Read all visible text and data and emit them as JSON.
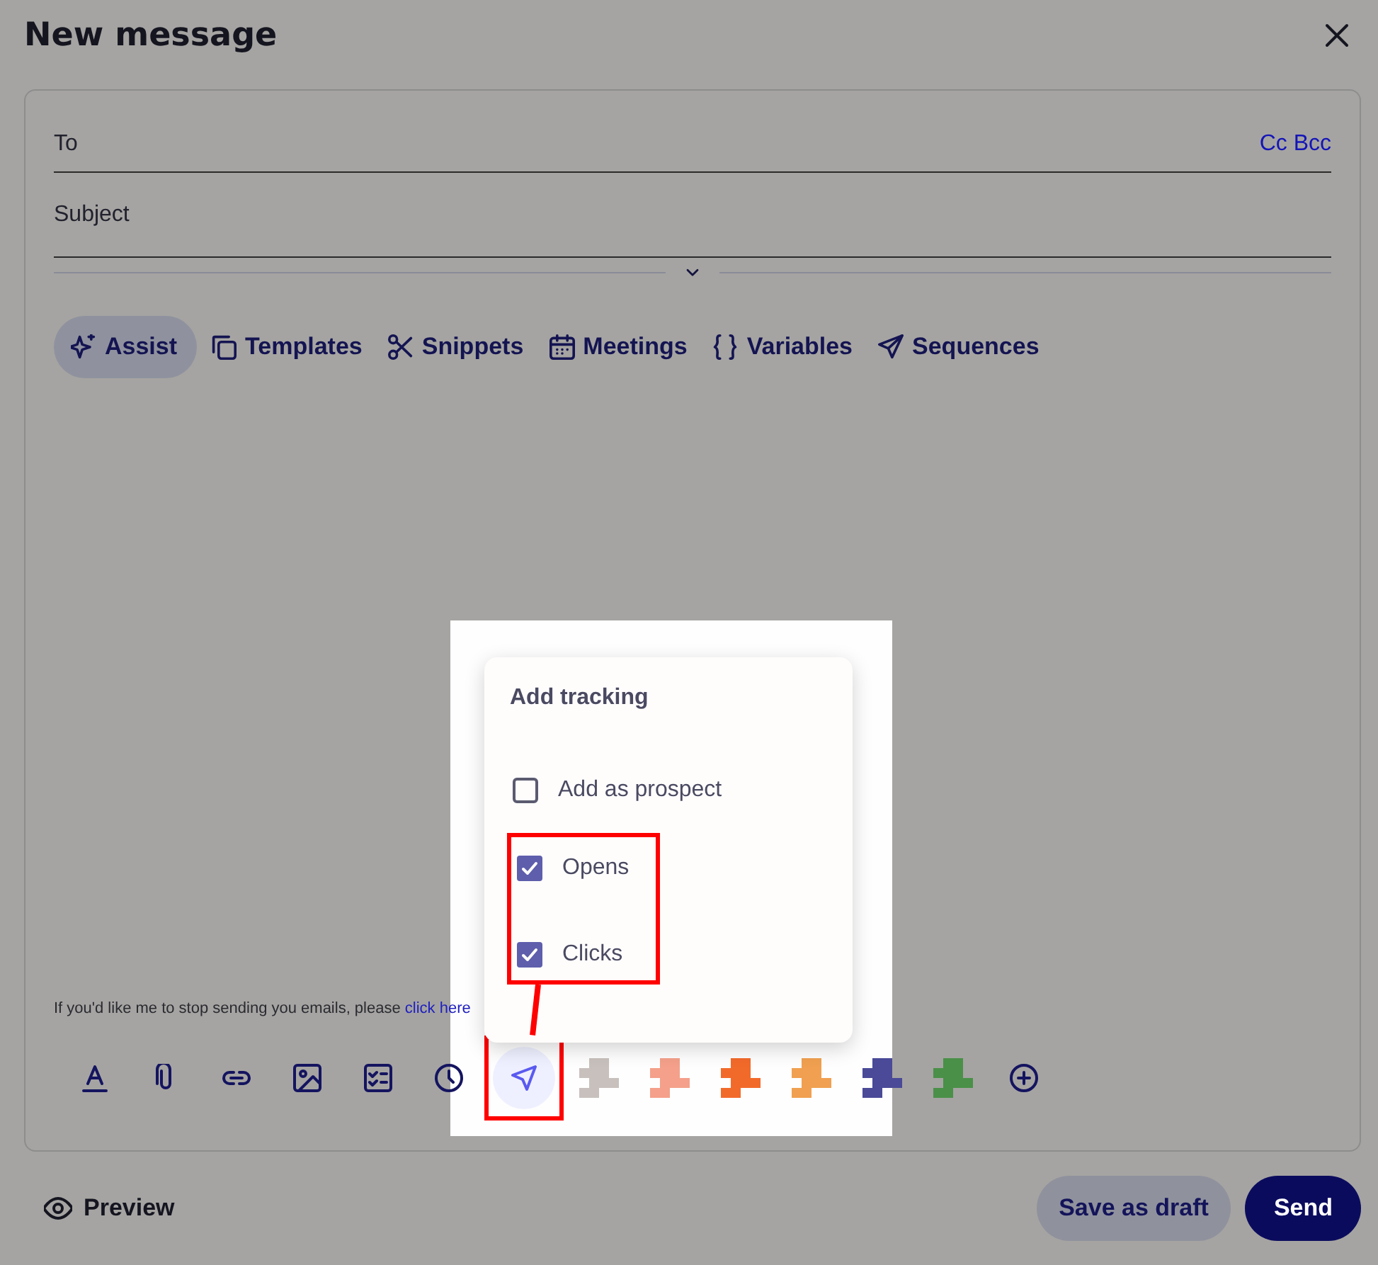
{
  "window": {
    "title": "New message"
  },
  "fields": [
    {
      "label": "To"
    },
    {
      "label": "Subject"
    }
  ],
  "cc_bcc": "Cc Bcc",
  "toolbar": [
    {
      "label": "Assist",
      "selected": true
    },
    {
      "label": "Templates",
      "selected": false
    },
    {
      "label": "Snippets",
      "selected": false
    },
    {
      "label": "Meetings",
      "selected": false
    },
    {
      "label": "Variables",
      "selected": false
    },
    {
      "label": "Sequences",
      "selected": false
    }
  ],
  "signature": {
    "text": "If you'd like me to stop sending you emails, please",
    "link": "click here"
  },
  "format_tools": [
    {
      "kind": "icon",
      "selected": false
    },
    {
      "kind": "icon",
      "selected": false
    },
    {
      "kind": "icon",
      "selected": false
    },
    {
      "kind": "icon",
      "selected": false
    },
    {
      "kind": "icon",
      "selected": false
    },
    {
      "kind": "icon",
      "selected": false
    },
    {
      "kind": "icon",
      "selected": true,
      "highlighted": true
    },
    {
      "kind": "pixelated",
      "color": "#c8c0bc",
      "selected": false
    },
    {
      "kind": "pixelated",
      "color": "#f4a08a",
      "selected": false
    },
    {
      "kind": "pixelated",
      "color": "#f26a2a",
      "selected": false
    },
    {
      "kind": "pixelated",
      "color": "#f0a050",
      "selected": false
    },
    {
      "kind": "pixelated",
      "color": "#4a4a98",
      "selected": false
    },
    {
      "kind": "pixelated",
      "color": "#4a9048",
      "selected": false
    },
    {
      "kind": "icon",
      "selected": false
    }
  ],
  "tracking_menu": {
    "title": "Add tracking",
    "options": [
      {
        "label": "Add as prospect",
        "checked": false,
        "highlighted": false
      },
      {
        "label": "Opens",
        "checked": true,
        "highlighted": true
      },
      {
        "label": "Clicks",
        "checked": true,
        "highlighted": true
      }
    ]
  },
  "footer": {
    "preview": "Preview",
    "buttons": [
      {
        "label": "Save as draft",
        "kind": "secondary"
      },
      {
        "label": "Send",
        "kind": "primary"
      }
    ]
  }
}
